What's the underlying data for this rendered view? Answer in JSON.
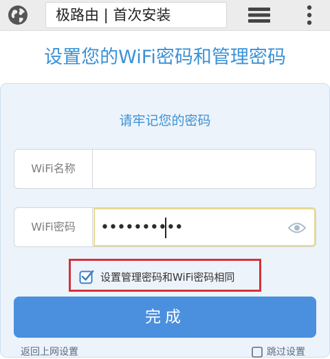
{
  "browser": {
    "address_text": "极路由 | 首次安装",
    "icons": [
      "globe-icon",
      "tabs-icon",
      "more-vertical-icon"
    ]
  },
  "page": {
    "title": "设置您的WiFi密码和管理密码",
    "subtitle": "请牢记您的密码"
  },
  "form": {
    "ssid": {
      "label": "WiFi名称",
      "value": ""
    },
    "password": {
      "label": "WiFi密码",
      "masked_value": "••••••••••",
      "icon": "eye-icon"
    },
    "same_password_checkbox": {
      "label": "设置管理密码和WiFi密码相同",
      "checked": true
    },
    "submit_label": "完成"
  },
  "footer": {
    "left_link": "返回上网设置",
    "right_link": "跳过设置"
  },
  "colors": {
    "accent": "#3a92d6",
    "button": "#4a90de",
    "highlight_border": "#d4313a",
    "card_background": "#edf3fa"
  }
}
